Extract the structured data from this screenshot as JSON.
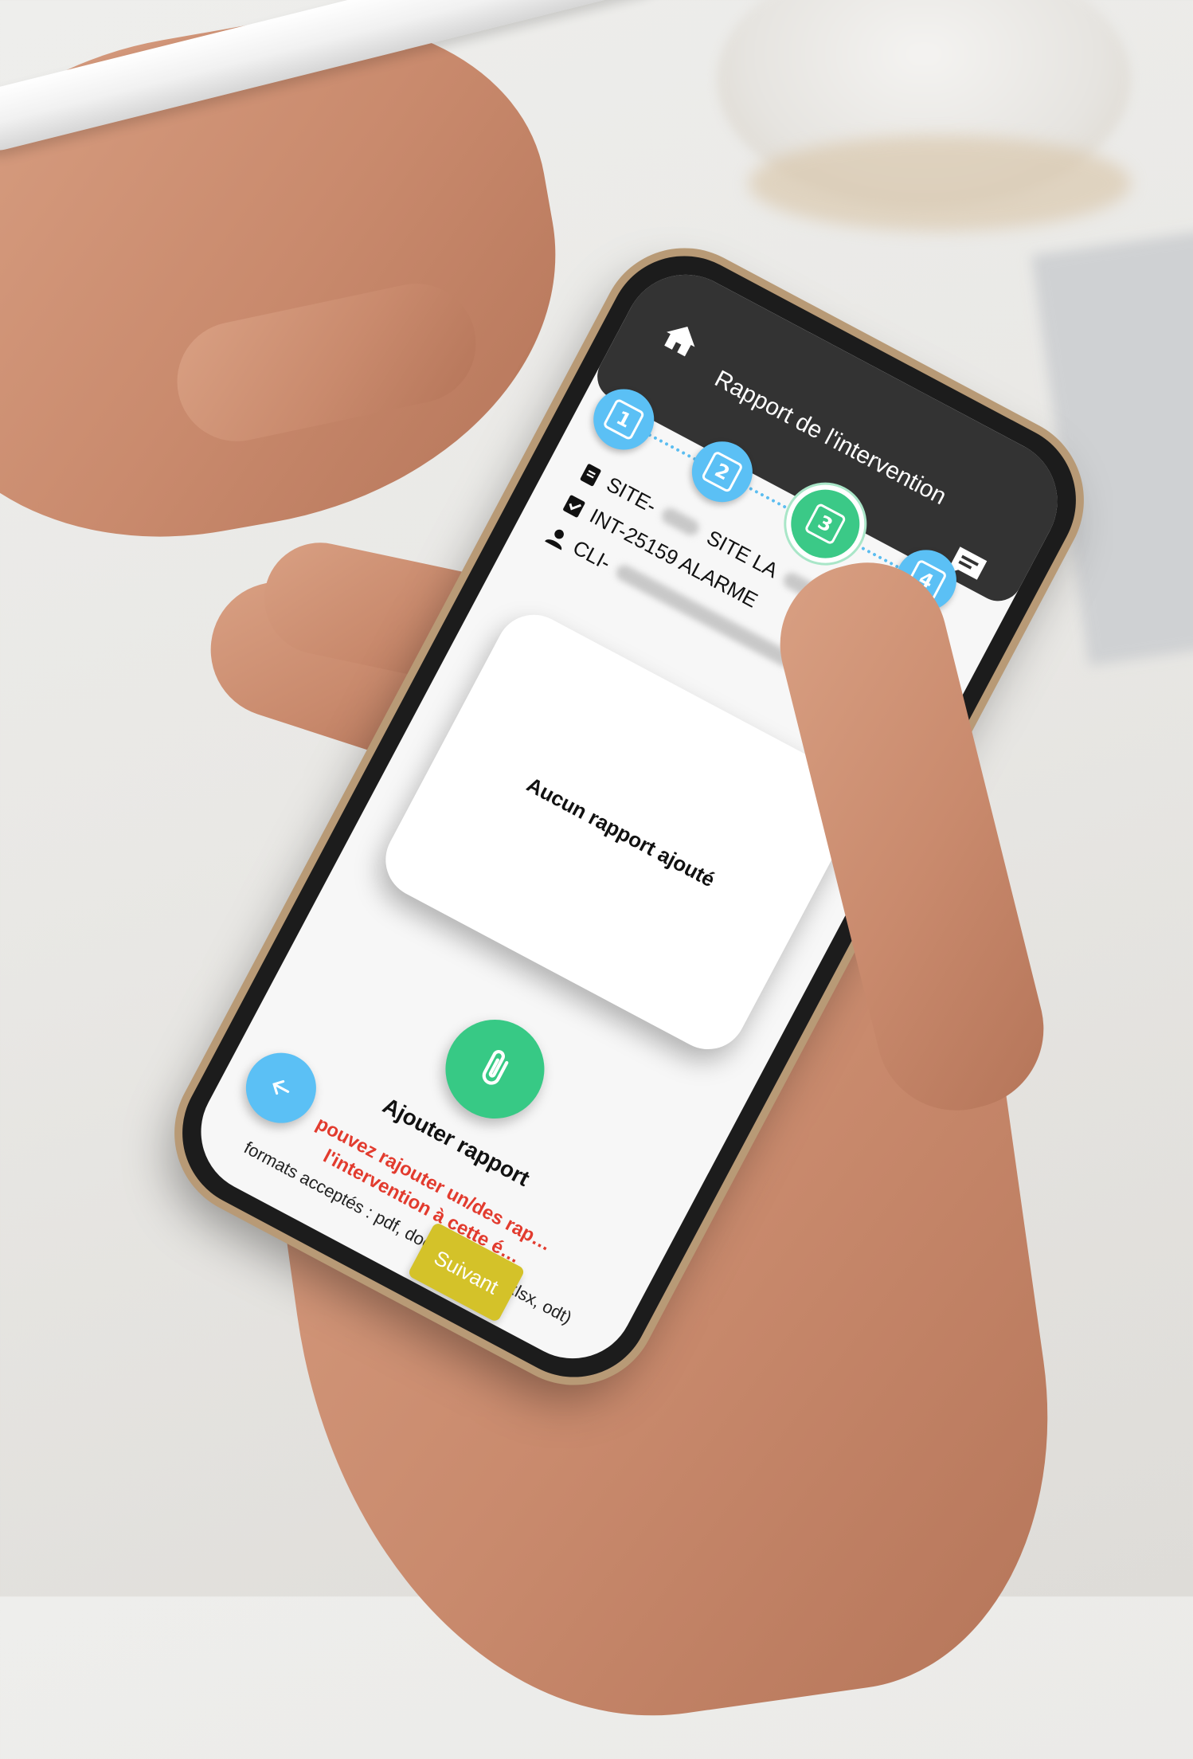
{
  "header": {
    "title": "Rapport de l'intervention",
    "home_icon": "home-icon",
    "chat_icon": "chat-icon"
  },
  "steps": [
    {
      "label": "1",
      "state": "done"
    },
    {
      "label": "2",
      "state": "done"
    },
    {
      "label": "3",
      "state": "active"
    },
    {
      "label": "4",
      "state": "pending"
    }
  ],
  "info": {
    "site_code": "SITE-",
    "site_name": "SITE LA",
    "intervention": "INT-25159 ALARME",
    "client": "CLI-"
  },
  "report_card": {
    "empty_text": "Aucun rapport ajouté"
  },
  "add_report": {
    "label": "Ajouter rapport",
    "icon": "paperclip-icon"
  },
  "notice": {
    "warning": "pouvez rajouter un/des rap… l'intervention à cette é…",
    "formats": "formats acceptés : pdf, docx, doc, xls, xlsx, odt)"
  },
  "buttons": {
    "back_icon": "arrow-left-icon",
    "next_label": "Suivant"
  },
  "colors": {
    "topbar": "#333333",
    "step_blue": "#5bc0f5",
    "step_green": "#3bc987",
    "clip_green": "#37c985",
    "next_yellow": "#d4c229",
    "warning_red": "#e23b2e"
  }
}
